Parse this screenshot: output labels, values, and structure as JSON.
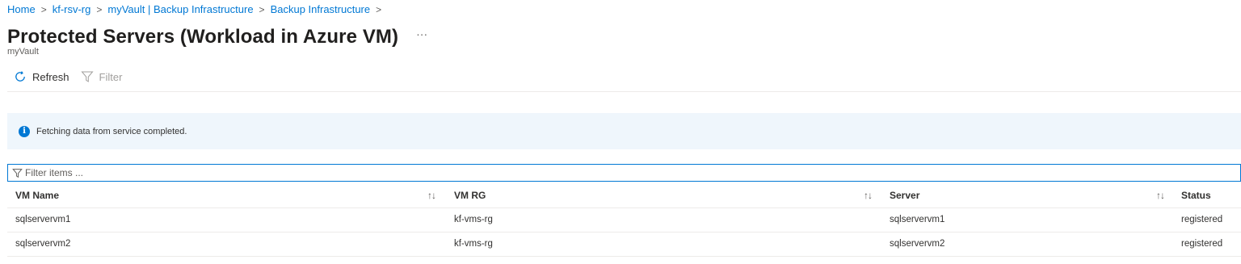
{
  "breadcrumb": {
    "items": [
      "Home",
      "kf-rsv-rg",
      "myVault | Backup Infrastructure",
      "Backup Infrastructure"
    ],
    "separator": ">"
  },
  "page": {
    "title": "Protected Servers (Workload in Azure VM)",
    "subtitle": "myVault",
    "more_icon": "···"
  },
  "toolbar": {
    "refresh_label": "Refresh",
    "filter_label": "Filter"
  },
  "info_banner": {
    "icon": "i",
    "message": "Fetching data from service completed."
  },
  "filter_box": {
    "placeholder": "Filter items ..."
  },
  "table": {
    "columns": [
      "VM Name",
      "VM RG",
      "Server",
      "Status"
    ],
    "sort_icon": "↑↓",
    "rows": [
      {
        "vm_name": "sqlservervm1",
        "vm_rg": "kf-vms-rg",
        "server": "sqlservervm1",
        "status": "registered"
      },
      {
        "vm_name": "sqlservervm2",
        "vm_rg": "kf-vms-rg",
        "server": "sqlservervm2",
        "status": "registered"
      }
    ]
  },
  "colors": {
    "accent": "#0078d4",
    "banner_bg": "#eff6fc",
    "divider": "#edebe9"
  }
}
